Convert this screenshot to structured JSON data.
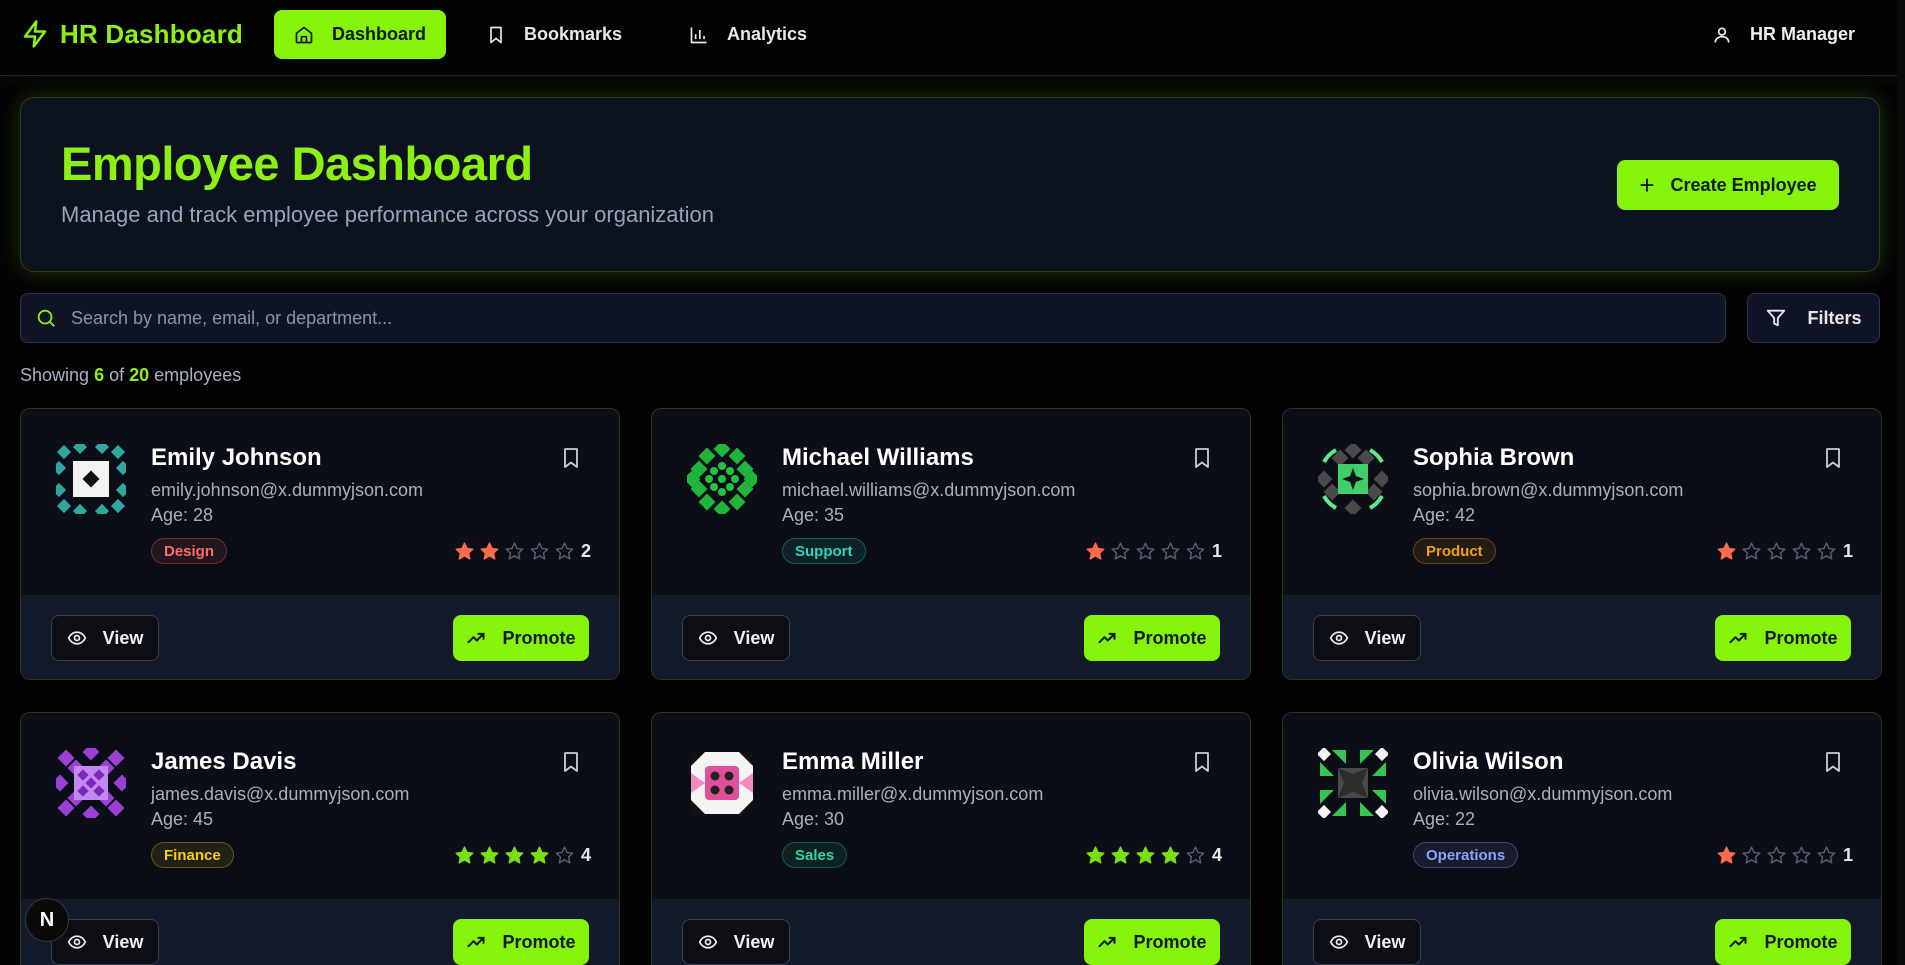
{
  "nav": {
    "brand": "HR Dashboard",
    "links": [
      {
        "label": "Dashboard",
        "active": true
      },
      {
        "label": "Bookmarks",
        "active": false
      },
      {
        "label": "Analytics",
        "active": false
      }
    ],
    "user": "HR Manager"
  },
  "hero": {
    "title": "Employee Dashboard",
    "subtitle": "Manage and track employee performance across your organization",
    "create_label": "Create Employee"
  },
  "search": {
    "placeholder": "Search by name, email, or department...",
    "value": ""
  },
  "filters_label": "Filters",
  "showing": {
    "prefix": "Showing",
    "count": "6",
    "of": "of",
    "total": "20",
    "suffix": "employees"
  },
  "card_actions": {
    "view": "View",
    "promote": "Promote"
  },
  "employees": [
    {
      "name": "Emily Johnson",
      "email": "emily.johnson@x.dummyjson.com",
      "age": "Age: 28",
      "department": "Design",
      "rating": "2"
    },
    {
      "name": "Michael Williams",
      "email": "michael.williams@x.dummyjson.com",
      "age": "Age: 35",
      "department": "Support",
      "rating": "1"
    },
    {
      "name": "Sophia Brown",
      "email": "sophia.brown@x.dummyjson.com",
      "age": "Age: 42",
      "department": "Product",
      "rating": "1"
    },
    {
      "name": "James Davis",
      "email": "james.davis@x.dummyjson.com",
      "age": "Age: 45",
      "department": "Finance",
      "rating": "4"
    },
    {
      "name": "Emma Miller",
      "email": "emma.miller@x.dummyjson.com",
      "age": "Age: 30",
      "department": "Sales",
      "rating": "4"
    },
    {
      "name": "Olivia Wilson",
      "email": "olivia.wilson@x.dummyjson.com",
      "age": "Age: 22",
      "department": "Operations",
      "rating": "1"
    }
  ],
  "colors": {
    "accent": "#86f40a",
    "star_low": "#ff6a4a",
    "star_high": "#7be012",
    "star_empty": "#5a6170",
    "dept": {
      "Design": "#ff6b6b",
      "Support": "#2dd4bf",
      "Product": "#f59e0b",
      "Finance": "#facc15",
      "Sales": "#34d399",
      "Operations": "#8fa0ff"
    }
  },
  "badge_letter": "N"
}
